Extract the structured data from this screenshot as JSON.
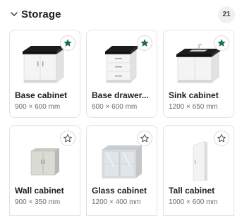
{
  "section": {
    "title": "Storage",
    "count": "21"
  },
  "colors": {
    "favorite_active": "#1e6b57",
    "favorite_inactive": "#4a4a4a"
  },
  "items": [
    {
      "name": "Base cabinet",
      "dims": "900 × 600 mm",
      "favorite": true,
      "icon": "base-cabinet-icon"
    },
    {
      "name": "Base drawer...",
      "dims": "600 × 600 mm",
      "favorite": true,
      "icon": "base-drawer-icon"
    },
    {
      "name": "Sink cabinet",
      "dims": "1200 × 650 mm",
      "favorite": true,
      "icon": "sink-cabinet-icon"
    },
    {
      "name": "Wall cabinet",
      "dims": "900 × 350 mm",
      "favorite": false,
      "icon": "wall-cabinet-icon"
    },
    {
      "name": "Glass cabinet",
      "dims": "1200 × 400 mm",
      "favorite": false,
      "icon": "glass-cabinet-icon"
    },
    {
      "name": "Tall cabinet",
      "dims": "1000 × 600 mm",
      "favorite": false,
      "icon": "tall-cabinet-icon"
    }
  ]
}
